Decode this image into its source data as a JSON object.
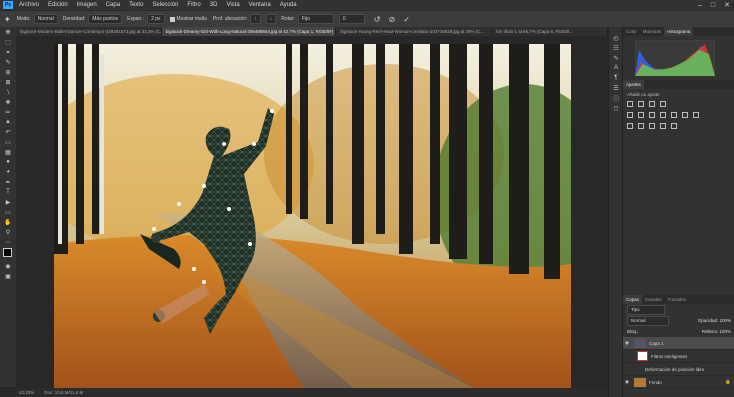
{
  "menubar": {
    "logo": "Ps",
    "items": [
      "Archivo",
      "Edición",
      "Imagen",
      "Capa",
      "Texto",
      "Selección",
      "Filtro",
      "3D",
      "Vista",
      "Ventana",
      "Ayuda"
    ]
  },
  "options": {
    "mode_label": "Modo:",
    "mode_value": "Normal",
    "density_label": "Densidad:",
    "density_value": "Más puntos",
    "expansion_label": "Expan.:",
    "expansion_value": "2 px",
    "show_mesh": "Mostrar malla",
    "pin_depth": "Prof. ubicación:",
    "rotate_label": "Rotar:",
    "rotate_value": "Fijo",
    "angle_value": "0"
  },
  "tabs": [
    {
      "label": "bigstock-Modern-Ballet-Dancer-Contempo-329381573.jpg al 33,3% (Ca..."
    },
    {
      "label": "bigstock-Dreamy-Girl-With-Long-Natural-306489844.jpg al 42,7% (Capa 1, RGB/8#)",
      "active": true
    },
    {
      "label": "bigstock-Young-Red-Head-Woman-Levitatio-303716828.jpg al 25% (C..."
    },
    {
      "label": "Sin título 1 al 66,7% (Capa 6, RGB/8..."
    }
  ],
  "status": {
    "zoom": "42,23%",
    "doc": "Doc: 10,6 M/11,6 M"
  },
  "panels": {
    "top_tabs": [
      "Color",
      "Muestras",
      "Histograma"
    ],
    "adjustments_title": "Ajustes",
    "adjustments_hint": "Añadir un ajuste",
    "layers_tabs": [
      "Capas",
      "Canales",
      "Trazados"
    ],
    "layer_filter": "Tipo",
    "blend_mode": "Normal",
    "opacity_label": "Opacidad:",
    "opacity_value": "100%",
    "lock_label": "Bloq.:",
    "fill_label": "Relleno:",
    "fill_value": "100%",
    "layers": [
      {
        "name": "Capa 1",
        "selected": true
      },
      {
        "name": "Filtros inteligentes"
      },
      {
        "name": "Deformación de posición libre"
      },
      {
        "name": "Fondo"
      }
    ]
  },
  "colors": {
    "accent": "#31a8ff",
    "panel_bg": "#323232",
    "canvas_bg": "#282828"
  }
}
